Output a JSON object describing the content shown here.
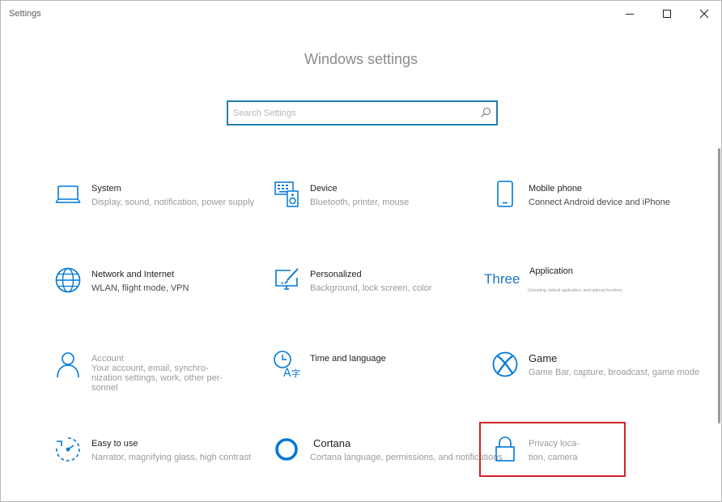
{
  "window": {
    "title": "Settings"
  },
  "page": {
    "title": "Windows settings"
  },
  "search": {
    "placeholder": "Search Settings",
    "value": ""
  },
  "colors": {
    "accent": "#0078d7",
    "search_border": "#1f7fae",
    "highlight": "#d2232a"
  },
  "tiles": [
    {
      "name": "System",
      "description": [
        "Display, sound, notification, power supply"
      ],
      "icon": "laptop-icon"
    },
    {
      "name": "Device",
      "description": [
        "Bluetooth, printer, mouse"
      ],
      "icon": "keyboard-speaker-icon"
    },
    {
      "name": "Mobile phone",
      "description": [
        "Connect Android device and iPhone"
      ],
      "icon": "phone-icon"
    },
    {
      "name": "Network and Internet",
      "description": [
        "WLAN, flight mode, VPN"
      ],
      "icon": "globe-icon"
    },
    {
      "name": "Personalized",
      "description": [
        "Background, lock screen, color"
      ],
      "icon": "paint-screen-icon"
    },
    {
      "name": "Application",
      "description": [
        "Unloading, default application, and optional functions"
      ],
      "icon": "apps-icon",
      "icon_text": "Three"
    },
    {
      "name": "Account",
      "description": [
        "Your account, email, synchro-",
        "nization settings, work, other per-",
        "sonnel"
      ],
      "icon": "person-icon"
    },
    {
      "name": "Time and language",
      "description": [],
      "icon": "clock-language-icon"
    },
    {
      "name": "Game",
      "description": [
        "Game Bar, capture, broadcast, game mode"
      ],
      "icon": "xbox-icon"
    },
    {
      "name": "Easy to use",
      "description": [
        "Narrator, magnifying glass, high contrast"
      ],
      "icon": "ease-of-access-icon"
    },
    {
      "name": "Cortana",
      "description": [
        "Cortana language, permissions, and notifications"
      ],
      "icon": "cortana-circle-icon"
    },
    {
      "name": "",
      "description": [
        "Privacy loca-",
        "tion, camera"
      ],
      "icon": "lock-icon"
    }
  ]
}
